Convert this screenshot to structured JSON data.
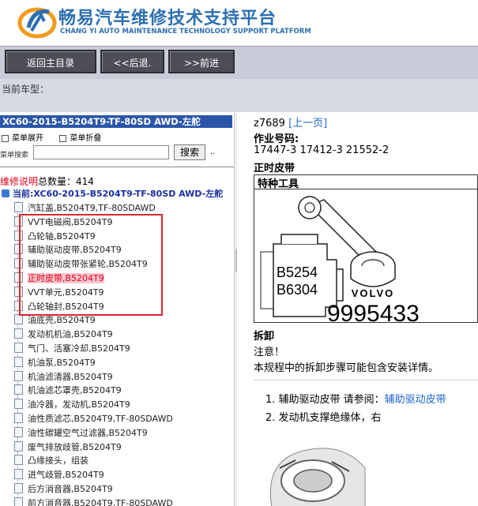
{
  "header": {
    "title": "畅易汽车维修技术支持平台",
    "subtitle": "CHANG YI AUTO MAINTENANCE TECHNOLOGY SUPPORT PLATFORM"
  },
  "toolbar": {
    "back_main": "返回主目录",
    "back": "<<后退.",
    "forward": ">>前进"
  },
  "current_model_label": "当前车型：",
  "left": {
    "header": "XC60-2015-B5204T9-TF-80SD AWD-左舵",
    "menu_expand": "菜单展开",
    "menu_collapse": "菜单折叠",
    "search_label": "菜单搜索",
    "search_value": "",
    "search_button": "搜索",
    "search_more": "..",
    "count_label": "维修说明",
    "count_text": "总数量：414",
    "current": "当前:XC60-2015-B5204T9-TF-80SD AWD-左舵",
    "items": [
      "汽缸盖,B5204T9,TF-80SDAWD",
      "VVT电磁阀,B5204T9",
      "凸轮轴,B5204T9",
      "辅助驱动皮带,B5204T9",
      "辅助驱动皮带张紧轮,B5204T9",
      "正时皮带,B5204T9",
      "VVT单元,B5204T9",
      "凸轮轴封,B5204T9",
      "油底壳,B5204T9",
      "发动机机油,B5204T9",
      "气门、活塞冷却,B5204T9",
      "机油泵,B5204T9",
      "机油滤清器,B5204T9",
      "机油滤芯罩壳,B5204T9",
      "油冷器，发动机,B5204T9",
      "油性质滤芯,B5204T9,TF-80SDAWD",
      "油性碳罐空气过滤器,B5204T9",
      "废气排放歧管,B5204T9",
      "凸缘接头，组装",
      "进气歧管,B5204T9",
      "后方消音器,B5204T9",
      "前方消音器,B5204T9,TF-80SDAWD"
    ],
    "selected_index": 5
  },
  "right": {
    "doc_id": "z7689",
    "prev_link": "[上一页]",
    "op_label": "作业号码:",
    "op_numbers": "17447-3 17412-3 21552-2",
    "section": "正时皮带",
    "tools_header": "特种工具",
    "tool_label_1": "B5254",
    "tool_label_2": "B6304",
    "tool_brand": "VOLVO",
    "tool_part": "9995433",
    "disassembly": "拆卸",
    "notice": "注意！",
    "notice_text": "本规程中的拆卸步骤可能包含安装详情。",
    "step1_prefix": "1. 辅助驱动皮带 请参阅：",
    "step1_link": "辅助驱动皮带",
    "step2": "2. 发动机支撑绝缘体，右"
  },
  "colors": {
    "brand_blue": "#2d6fb0",
    "header_bar": "#2b56a8",
    "highlight_red": "#e0001b",
    "link_blue": "#2266cc"
  }
}
